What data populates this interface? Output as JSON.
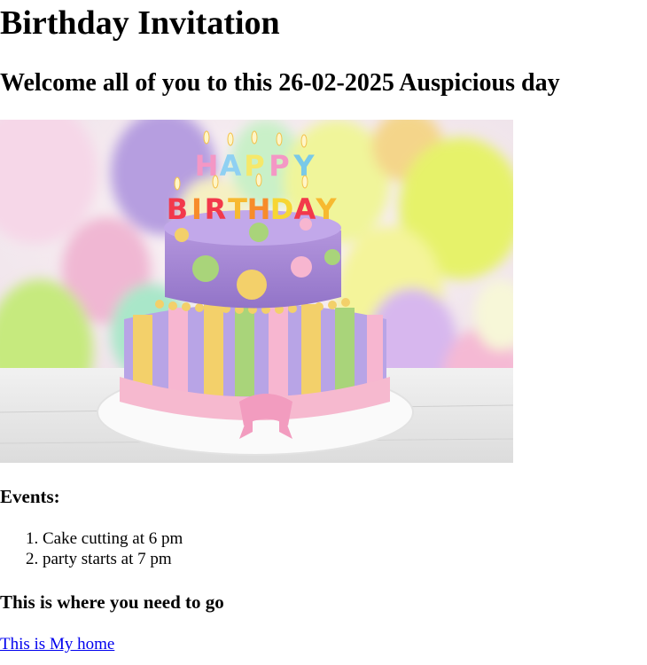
{
  "page": {
    "title": "Birthday Invitation",
    "welcome": "Welcome all of you to this 26-02-2025 Auspicious day"
  },
  "image": {
    "subject": "birthday-cake-photo",
    "candle_letters_top": "HAPPY",
    "candle_letters_bottom": "BIRTHDAY"
  },
  "events": {
    "heading": "Events:",
    "items": [
      "Cake cutting at 6 pm",
      "party starts at 7 pm"
    ]
  },
  "directions": {
    "heading": "This is where you need to go",
    "link_text": "This is My home"
  },
  "colors": {
    "link": "#0000ee"
  }
}
